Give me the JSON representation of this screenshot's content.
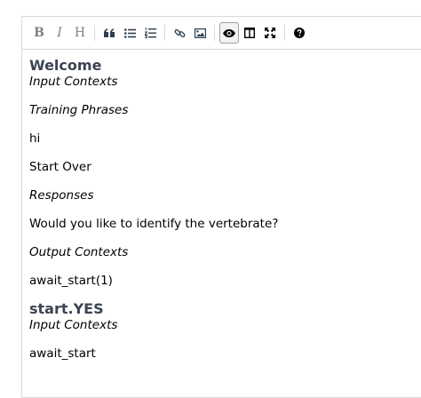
{
  "toolbar": {
    "buttons": [
      {
        "name": "bold-button",
        "glyph": "B"
      },
      {
        "name": "italic-button",
        "glyph": "I"
      },
      {
        "name": "heading-button",
        "glyph": "H"
      },
      {
        "name": "quote-button",
        "icon": "quote-icon"
      },
      {
        "name": "unordered-list-button",
        "icon": "bullet-list-icon"
      },
      {
        "name": "ordered-list-button",
        "icon": "numbered-list-icon"
      },
      {
        "name": "link-button",
        "icon": "link-icon"
      },
      {
        "name": "image-button",
        "icon": "image-icon"
      },
      {
        "name": "preview-button",
        "icon": "eye-icon",
        "active": true
      },
      {
        "name": "side-by-side-button",
        "icon": "columns-icon"
      },
      {
        "name": "fullscreen-button",
        "icon": "fullscreen-icon"
      },
      {
        "name": "guide-button",
        "icon": "question-icon"
      }
    ]
  },
  "content": {
    "section1": {
      "title": "Welcome",
      "input_contexts_label": "Input Contexts",
      "training_phrases_label": "Training Phrases",
      "phrase1": "hi",
      "phrase2": "Start Over",
      "responses_label": "Responses",
      "response1": "Would you like to identify the vertebrate?",
      "output_contexts_label": "Output Contexts",
      "output_context1": "await_start(1)"
    },
    "section2": {
      "title": "start.YES",
      "input_contexts_label": "Input Contexts",
      "input_context1": "await_start"
    }
  },
  "colors": {
    "icon": "#2c3e50",
    "heading": "#3c4451",
    "border": "#d9d9d9"
  }
}
